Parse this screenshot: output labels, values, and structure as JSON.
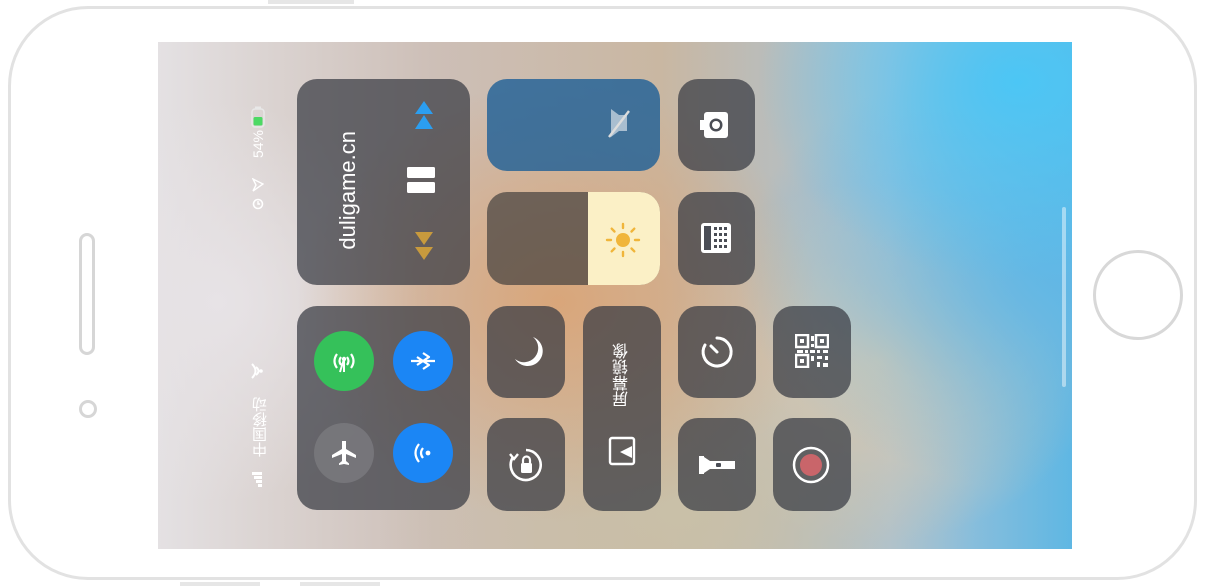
{
  "status_bar": {
    "carrier": "中国移动",
    "battery": "54%",
    "icons": [
      "signal-icon",
      "wifi-icon",
      "alarm-icon",
      "location-icon",
      "battery-icon"
    ]
  },
  "music": {
    "title": "duligame.cn",
    "icons": [
      "previous-icon",
      "pause-icon",
      "next-icon"
    ]
  },
  "connectivity": {
    "icons": [
      "cellular-data-icon",
      "bluetooth-icon",
      "airplane-mode-icon",
      "airdrop-icon"
    ],
    "colors": {
      "cellular": "#35c15a",
      "bluetooth": "#1b86f5",
      "airdrop": "#1b86f5",
      "airplane": "#6f6f74"
    }
  },
  "screen_mirroring": {
    "label": "屏幕镜像"
  },
  "controls": {
    "icons": [
      "mute-icon",
      "camera-icon",
      "calculator-icon",
      "brightness-icon",
      "do-not-disturb-icon",
      "rotation-lock-icon",
      "timer-icon",
      "qr-code-icon",
      "flashlight-icon",
      "screen-record-icon"
    ]
  },
  "brightness": {
    "level": 0.42
  }
}
